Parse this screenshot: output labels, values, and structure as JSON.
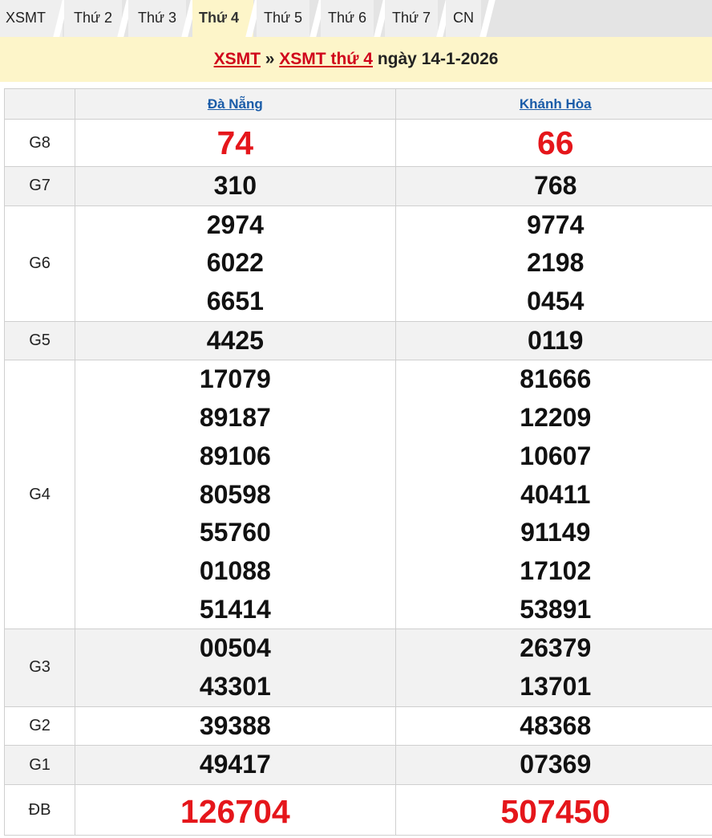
{
  "tabs": [
    {
      "label": "XSMT",
      "active": false
    },
    {
      "label": "Thứ 2",
      "active": false
    },
    {
      "label": "Thứ 3",
      "active": false
    },
    {
      "label": "Thứ 4",
      "active": true
    },
    {
      "label": "Thứ 5",
      "active": false
    },
    {
      "label": "Thứ 6",
      "active": false
    },
    {
      "label": "Thứ 7",
      "active": false
    },
    {
      "label": "CN",
      "active": false
    }
  ],
  "banner": {
    "link1": "XSMT",
    "sep": "»",
    "link2": "XSMT thứ 4",
    "date_text": "ngày 14-1-2026"
  },
  "provinces": [
    "Đà Nẵng",
    "Khánh Hòa"
  ],
  "prizes": [
    {
      "label": "G8",
      "cols": [
        [
          "74"
        ],
        [
          "66"
        ]
      ]
    },
    {
      "label": "G7",
      "cols": [
        [
          "310"
        ],
        [
          "768"
        ]
      ]
    },
    {
      "label": "G6",
      "cols": [
        [
          "2974",
          "6022",
          "6651"
        ],
        [
          "9774",
          "2198",
          "0454"
        ]
      ]
    },
    {
      "label": "G5",
      "cols": [
        [
          "4425"
        ],
        [
          "0119"
        ]
      ]
    },
    {
      "label": "G4",
      "cols": [
        [
          "17079",
          "89187",
          "89106",
          "80598",
          "55760",
          "01088",
          "51414"
        ],
        [
          "81666",
          "12209",
          "10607",
          "40411",
          "91149",
          "17102",
          "53891"
        ]
      ]
    },
    {
      "label": "G3",
      "cols": [
        [
          "00504",
          "43301"
        ],
        [
          "26379",
          "13701"
        ]
      ]
    },
    {
      "label": "G2",
      "cols": [
        [
          "39388"
        ],
        [
          "48368"
        ]
      ]
    },
    {
      "label": "G1",
      "cols": [
        [
          "49417"
        ],
        [
          "07369"
        ]
      ]
    },
    {
      "label": "ĐB",
      "cols": [
        [
          "126704"
        ],
        [
          "507450"
        ]
      ]
    }
  ],
  "colors": {
    "red": "#e5161b",
    "link_blue": "#1a5ca8",
    "banner_bg": "#fdf5c9"
  }
}
